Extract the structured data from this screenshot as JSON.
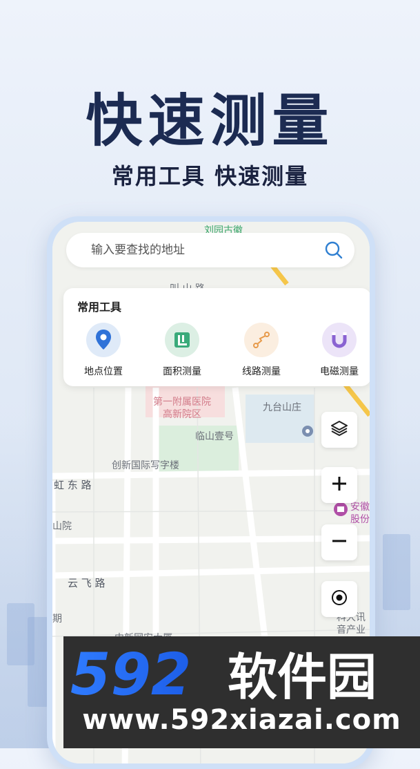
{
  "hero": {
    "title": "快速测量",
    "subtitle": "常用工具 快速测量"
  },
  "search": {
    "placeholder": "输入要查找的地址",
    "icon": "search-icon"
  },
  "tools": {
    "title": "常用工具",
    "items": [
      {
        "label": "地点位置",
        "icon": "location-pin-icon",
        "color": "#3a7be0"
      },
      {
        "label": "面积测量",
        "icon": "area-grid-icon",
        "color": "#3aaa7a"
      },
      {
        "label": "线路测量",
        "icon": "route-line-icon",
        "color": "#e79a4a"
      },
      {
        "label": "电磁测量",
        "icon": "magnet-icon",
        "color": "#8a63d2"
      }
    ]
  },
  "map": {
    "labels": {
      "top_road_1": "刘园古徽",
      "road_partial": "叫 山 路",
      "hospital_1": "第一附属医院",
      "hospital_2": "高新院区",
      "jiutai": "九台山庄",
      "linshan": "临山壹号",
      "office": "创新国际写字楼",
      "hongdong": "虹 东 路",
      "shanyuan": "山院",
      "yunfei": "云 飞 路",
      "qi": "期",
      "zhongxin": "中新网安大厦",
      "right_1": "安徽",
      "right_2": "股份",
      "right_3": "科大讯",
      "right_4": "音产业"
    }
  },
  "controls": {
    "layers": "layers-icon",
    "zoom_in": "plus-icon",
    "zoom_out": "minus-icon",
    "locate": "locate-icon"
  },
  "watermark": {
    "brand_num": "592",
    "brand_text": "软件园",
    "url": "www.592xiazai.com"
  }
}
